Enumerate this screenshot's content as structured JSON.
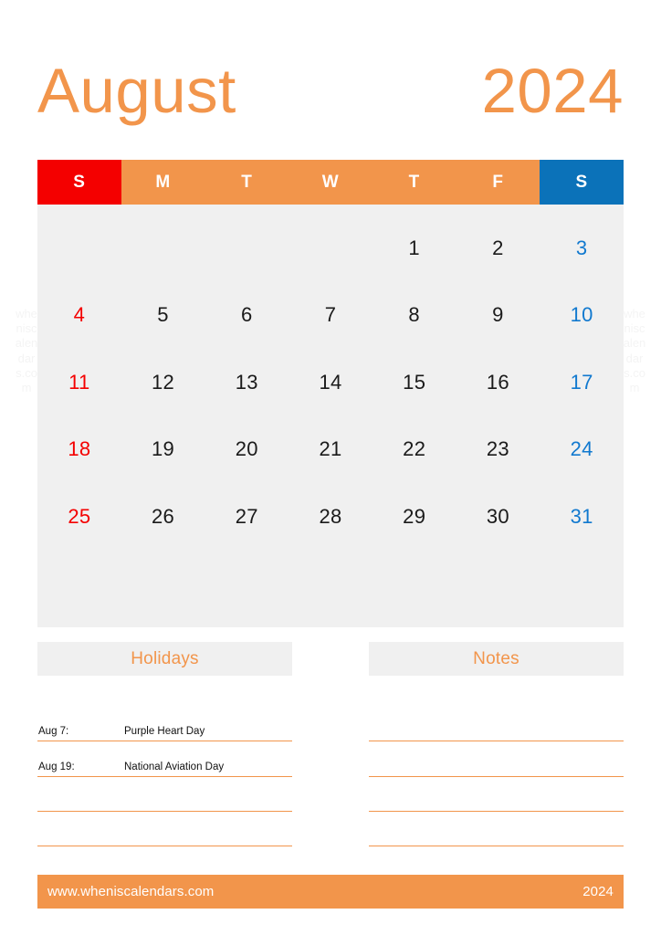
{
  "header": {
    "month": "August",
    "year": "2024"
  },
  "watermark": {
    "text": "wheniscalendars.com"
  },
  "colors": {
    "accent_orange": "#F2954B",
    "sunday_red": "#F40000",
    "saturday_blue": "#0B72B9",
    "saturday_text_blue": "#1179CF",
    "grid_background": "#F0F0F0",
    "text_dark": "#1A1A1A",
    "page_background": "#FFFFFF"
  },
  "calendar": {
    "weekdays": [
      {
        "label": "S",
        "kind": "sun"
      },
      {
        "label": "M",
        "kind": "weekday"
      },
      {
        "label": "T",
        "kind": "weekday"
      },
      {
        "label": "W",
        "kind": "weekday"
      },
      {
        "label": "T",
        "kind": "weekday"
      },
      {
        "label": "F",
        "kind": "weekday"
      },
      {
        "label": "S",
        "kind": "sat"
      }
    ],
    "weeks": [
      [
        {
          "label": "",
          "kind": "empty"
        },
        {
          "label": "",
          "kind": "empty"
        },
        {
          "label": "",
          "kind": "empty"
        },
        {
          "label": "",
          "kind": "empty"
        },
        {
          "label": "1",
          "kind": "weekday"
        },
        {
          "label": "2",
          "kind": "weekday"
        },
        {
          "label": "3",
          "kind": "sat"
        }
      ],
      [
        {
          "label": "4",
          "kind": "sun"
        },
        {
          "label": "5",
          "kind": "weekday"
        },
        {
          "label": "6",
          "kind": "weekday"
        },
        {
          "label": "7",
          "kind": "weekday"
        },
        {
          "label": "8",
          "kind": "weekday"
        },
        {
          "label": "9",
          "kind": "weekday"
        },
        {
          "label": "10",
          "kind": "sat"
        }
      ],
      [
        {
          "label": "11",
          "kind": "sun"
        },
        {
          "label": "12",
          "kind": "weekday"
        },
        {
          "label": "13",
          "kind": "weekday"
        },
        {
          "label": "14",
          "kind": "weekday"
        },
        {
          "label": "15",
          "kind": "weekday"
        },
        {
          "label": "16",
          "kind": "weekday"
        },
        {
          "label": "17",
          "kind": "sat"
        }
      ],
      [
        {
          "label": "18",
          "kind": "sun"
        },
        {
          "label": "19",
          "kind": "weekday"
        },
        {
          "label": "20",
          "kind": "weekday"
        },
        {
          "label": "21",
          "kind": "weekday"
        },
        {
          "label": "22",
          "kind": "weekday"
        },
        {
          "label": "23",
          "kind": "weekday"
        },
        {
          "label": "24",
          "kind": "sat"
        }
      ],
      [
        {
          "label": "25",
          "kind": "sun"
        },
        {
          "label": "26",
          "kind": "weekday"
        },
        {
          "label": "27",
          "kind": "weekday"
        },
        {
          "label": "28",
          "kind": "weekday"
        },
        {
          "label": "29",
          "kind": "weekday"
        },
        {
          "label": "30",
          "kind": "weekday"
        },
        {
          "label": "31",
          "kind": "sat"
        }
      ],
      [
        {
          "label": "",
          "kind": "empty"
        },
        {
          "label": "",
          "kind": "empty"
        },
        {
          "label": "",
          "kind": "empty"
        },
        {
          "label": "",
          "kind": "empty"
        },
        {
          "label": "",
          "kind": "empty"
        },
        {
          "label": "",
          "kind": "empty"
        },
        {
          "label": "",
          "kind": "empty"
        }
      ]
    ]
  },
  "holidays": {
    "title": "Holidays",
    "rows": [
      {
        "date": "Aug 7:",
        "name": "Purple Heart Day"
      },
      {
        "date": "Aug 19:",
        "name": "National Aviation Day"
      },
      {
        "date": "",
        "name": ""
      },
      {
        "date": "",
        "name": ""
      },
      {
        "date": "",
        "name": ""
      }
    ]
  },
  "notes": {
    "title": "Notes",
    "rows": [
      {
        "text": ""
      },
      {
        "text": ""
      },
      {
        "text": ""
      },
      {
        "text": ""
      },
      {
        "text": ""
      }
    ]
  },
  "footer": {
    "url": "www.wheniscalendars.com",
    "year": "2024"
  }
}
